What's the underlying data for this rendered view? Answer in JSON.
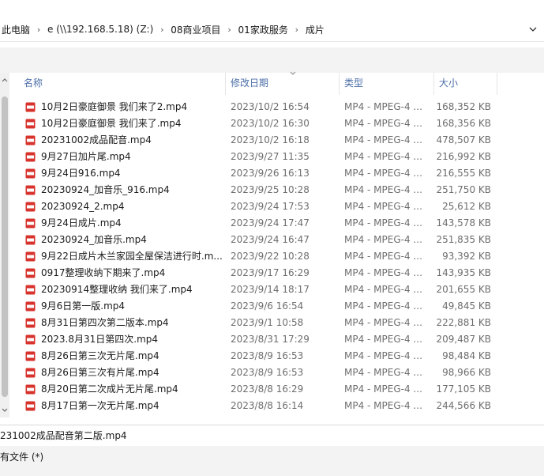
{
  "breadcrumb": {
    "items": [
      "此电脑",
      "e (\\\\192.168.5.18) (Z:)",
      "08商业项目",
      "01家政服务",
      "成片"
    ]
  },
  "columns": {
    "name": "名称",
    "date": "修改日期",
    "type": "类型",
    "size": "大小"
  },
  "files": [
    {
      "name": "10月2日豪庭御景 我们来了2.mp4",
      "date": "2023/10/2 16:54",
      "type": "MP4 - MPEG-4 ...",
      "size": "168,352 KB"
    },
    {
      "name": "10月2日豪庭御景 我们来了.mp4",
      "date": "2023/10/2 16:30",
      "type": "MP4 - MPEG-4 ...",
      "size": "168,356 KB"
    },
    {
      "name": "20231002成品配音.mp4",
      "date": "2023/10/2 16:18",
      "type": "MP4 - MPEG-4 ...",
      "size": "478,507 KB"
    },
    {
      "name": "9月27日加片尾.mp4",
      "date": "2023/9/27 11:35",
      "type": "MP4 - MPEG-4 ...",
      "size": "216,992 KB"
    },
    {
      "name": "9月24日916.mp4",
      "date": "2023/9/26 16:13",
      "type": "MP4 - MPEG-4 ...",
      "size": "216,555 KB"
    },
    {
      "name": "20230924_加音乐_916.mp4",
      "date": "2023/9/25 10:28",
      "type": "MP4 - MPEG-4 ...",
      "size": "251,750 KB"
    },
    {
      "name": "20230924_2.mp4",
      "date": "2023/9/24 17:53",
      "type": "MP4 - MPEG-4 ...",
      "size": "25,612 KB"
    },
    {
      "name": "9月24日成片.mp4",
      "date": "2023/9/24 17:47",
      "type": "MP4 - MPEG-4 ...",
      "size": "143,578 KB"
    },
    {
      "name": "20230924_加音乐.mp4",
      "date": "2023/9/24 16:47",
      "type": "MP4 - MPEG-4 ...",
      "size": "251,835 KB"
    },
    {
      "name": "9月22日成片木兰家园全屋保洁进行时.m...",
      "date": "2023/9/22 10:28",
      "type": "MP4 - MPEG-4 ...",
      "size": "93,392 KB"
    },
    {
      "name": "0917整理收纳下期来了.mp4",
      "date": "2023/9/17 16:29",
      "type": "MP4 - MPEG-4 ...",
      "size": "143,935 KB"
    },
    {
      "name": "20230914整理收纳 我们来了.mp4",
      "date": "2023/9/14 18:17",
      "type": "MP4 - MPEG-4 ...",
      "size": "201,655 KB"
    },
    {
      "name": "9月6日第一版.mp4",
      "date": "2023/9/6 16:54",
      "type": "MP4 - MPEG-4 ...",
      "size": "49,845 KB"
    },
    {
      "name": "8月31日第四次第二版本.mp4",
      "date": "2023/9/1 10:58",
      "type": "MP4 - MPEG-4 ...",
      "size": "222,881 KB"
    },
    {
      "name": "2023.8月31日第四次.mp4",
      "date": "2023/8/31 17:29",
      "type": "MP4 - MPEG-4 ...",
      "size": "209,487 KB"
    },
    {
      "name": "8月26日第三次无片尾.mp4",
      "date": "2023/8/9 16:53",
      "type": "MP4 - MPEG-4 ...",
      "size": "98,484 KB"
    },
    {
      "name": "8月26日第三次有片尾.mp4",
      "date": "2023/8/9 16:53",
      "type": "MP4 - MPEG-4 ...",
      "size": "98,966 KB"
    },
    {
      "name": "8月20日第二次成片无片尾.mp4",
      "date": "2023/8/8 16:29",
      "type": "MP4 - MPEG-4 ...",
      "size": "177,105 KB"
    },
    {
      "name": "8月17日第一次无片尾.mp4",
      "date": "2023/8/8 16:14",
      "type": "MP4 - MPEG-4 ...",
      "size": "244,566 KB"
    }
  ],
  "filename_field": {
    "value": "231002成品配音第二版.mp4"
  },
  "filetype_field": {
    "value": "有文件 (*)"
  },
  "colors": {
    "header_text": "#4c6ea8",
    "secondary_text": "#6d6d6d",
    "icon_red": "#d7322c",
    "toolbar_bg": "#f3f3f3"
  },
  "icons": {
    "file": "mp4-video-file-icon",
    "chevron": "chevron-down-icon",
    "breadcrumb_sep": "chevron-right-icon"
  }
}
